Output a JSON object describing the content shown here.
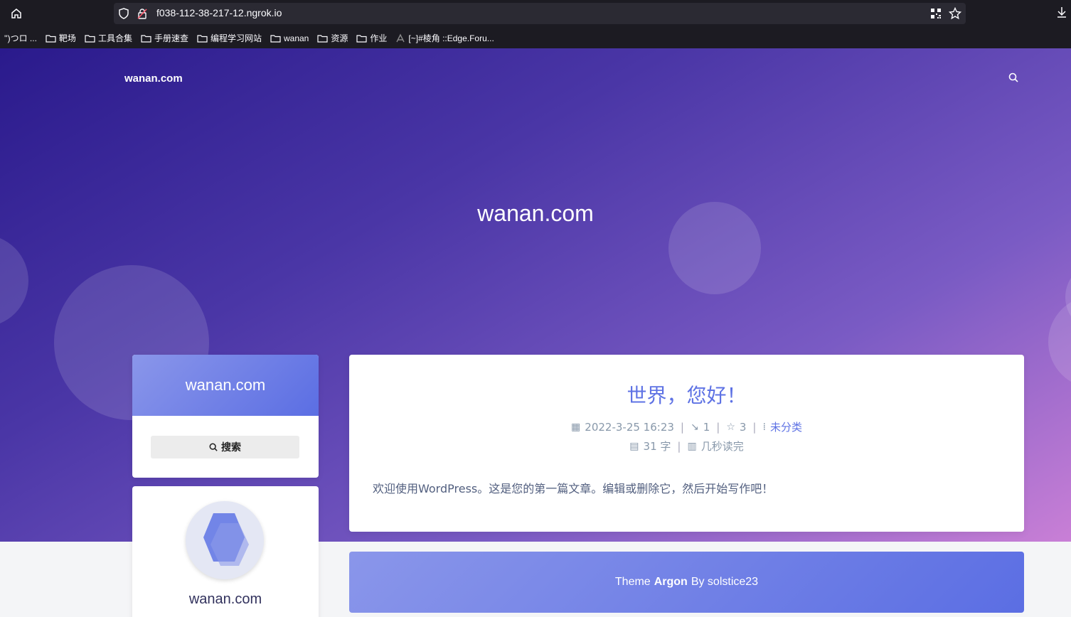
{
  "browser": {
    "url": "f038-112-38-217-12.ngrok.io",
    "bookmarks": [
      {
        "label": "'')つロ ...",
        "icon": "emoticon"
      },
      {
        "label": "靶场",
        "icon": "folder-icon"
      },
      {
        "label": "工具合集",
        "icon": "folder-icon"
      },
      {
        "label": "手册速查",
        "icon": "folder-icon"
      },
      {
        "label": "编程学习网站",
        "icon": "folder-icon"
      },
      {
        "label": "wanan",
        "icon": "folder-icon"
      },
      {
        "label": "资源",
        "icon": "folder-icon"
      },
      {
        "label": "作业",
        "icon": "folder-icon"
      },
      {
        "label": "[~]#棱角 ::Edge.Foru...",
        "icon": "site-icon"
      }
    ]
  },
  "nav": {
    "brand": "wanan.com",
    "search_icon": "search-icon"
  },
  "hero": {
    "title": "wanan.com"
  },
  "sidebar": {
    "site_title": "wanan.com",
    "search_label": "搜索",
    "author_name": "wanan.com"
  },
  "post": {
    "title": "世界，您好！",
    "date": "2022-3-25 16:23",
    "comments": "1",
    "views": "3",
    "category": "未分类",
    "word_count": "31 字",
    "read_time": "几秒读完",
    "excerpt": "欢迎使用WordPress。这是您的第一篇文章。编辑或删除它，然后开始写作吧！"
  },
  "footer": {
    "prefix": "Theme",
    "theme": "Argon",
    "suffix": "By solstice23"
  },
  "colors": {
    "accent": "#5e72e4",
    "chrome_bg": "#1c1b22"
  }
}
